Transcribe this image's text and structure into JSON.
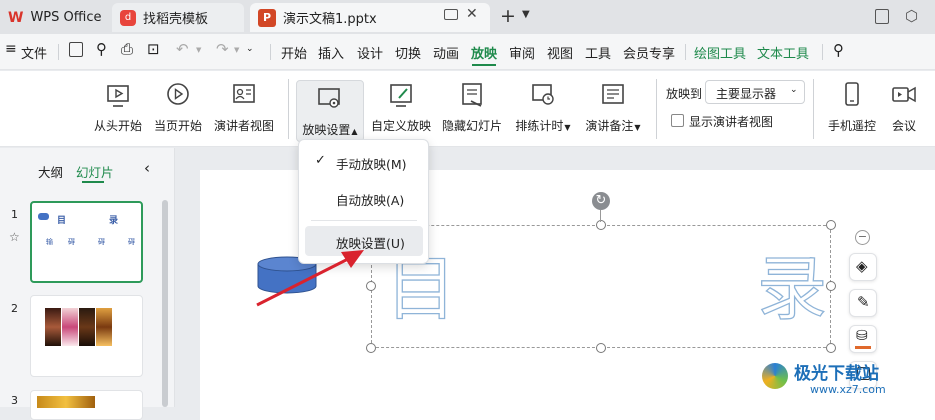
{
  "titlebar": {
    "tabs": [
      {
        "label": "WPS Office"
      },
      {
        "label": "找稻壳模板"
      },
      {
        "label": "演示文稿1.pptx"
      }
    ]
  },
  "menubar": {
    "file": "文件",
    "items": [
      "开始",
      "插入",
      "设计",
      "切换",
      "动画",
      "放映",
      "审阅",
      "视图",
      "工具",
      "会员专享",
      "绘图工具",
      "文本工具"
    ]
  },
  "ribbon": {
    "from_start": "从头开始",
    "from_current": "当页开始",
    "presenter_view": "演讲者视图",
    "slideshow_settings": "放映设置",
    "custom_show": "自定义放映",
    "hide_slide": "隐藏幻灯片",
    "rehearse": "排练计时",
    "speaker_notes": "演讲备注",
    "show_on": "放映到",
    "monitor": "主要显示器",
    "show_presenter": "显示演讲者视图",
    "remote": "手机遥控",
    "meeting": "会议"
  },
  "sidebar": {
    "tab_outline": "大纲",
    "tab_slides": "幻灯片",
    "slide_numbers": [
      "1",
      "2",
      "3"
    ],
    "thumb1": {
      "title_left": "目",
      "title_right": "录",
      "items": [
        "输",
        "碍",
        "碍",
        "碍"
      ]
    }
  },
  "dropdown": {
    "manual": "手动放映(M)",
    "auto": "自动放映(A)",
    "settings": "放映设置(U)"
  },
  "slide": {
    "left_char": "目",
    "right_char": "录"
  },
  "watermark": {
    "name": "极光下载站",
    "url": "www.xz7.com"
  },
  "colors": {
    "accent": "#1f8a4c",
    "wps_red": "#d9342b",
    "ppt_orange": "#d24726",
    "arrow": "#d9232e",
    "cylinder": "#4472c4"
  }
}
